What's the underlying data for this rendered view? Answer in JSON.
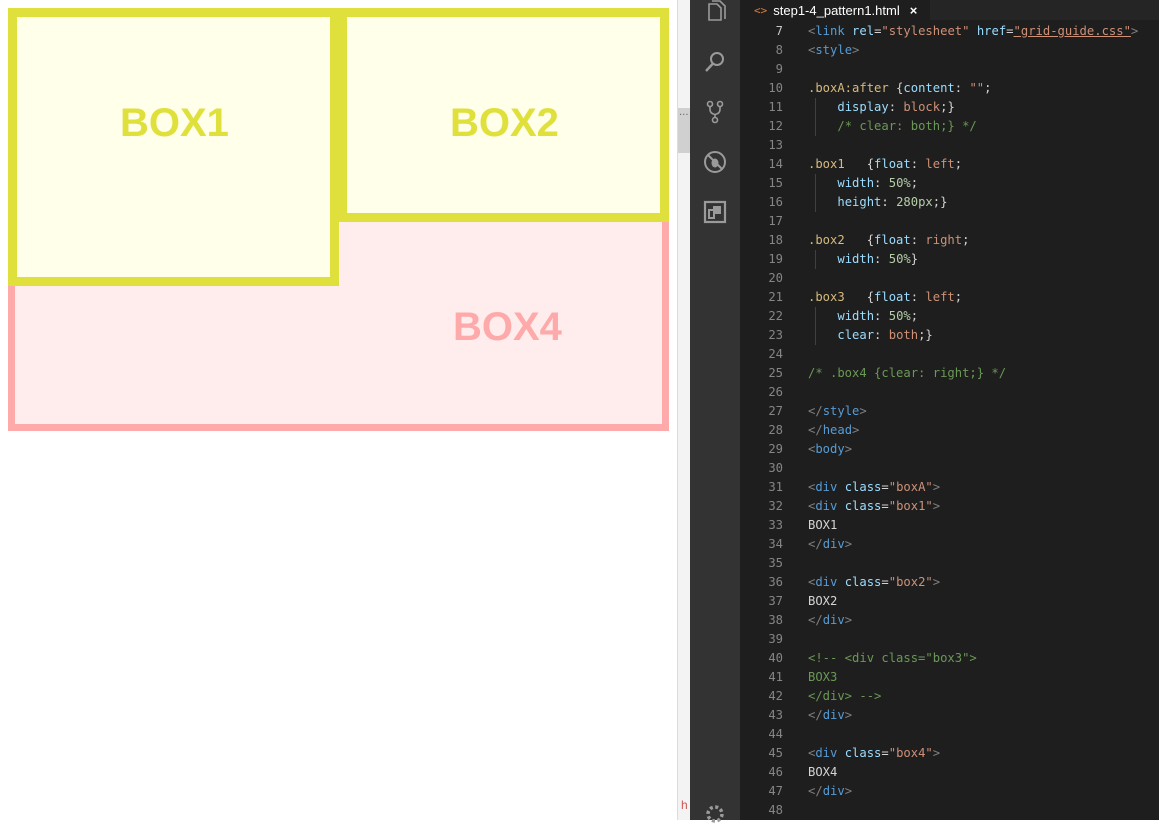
{
  "preview": {
    "box1_label": "BOX1",
    "box2_label": "BOX2",
    "box4_label": "BOX4",
    "colors": {
      "yellow": "#e0e03c",
      "pink": "#ffaaaa"
    }
  },
  "divider": {
    "grip": "···",
    "letter": "h"
  },
  "tab": {
    "icon": "<>",
    "filename": "step1-4_pattern1.html",
    "close": "×"
  },
  "activity_icons": [
    "explorer-icon",
    "search-icon",
    "source-control-icon",
    "debug-icon",
    "extensions-icon",
    "settings-gear-icon"
  ],
  "code_lines": [
    {
      "n": "7",
      "tokens": [
        [
          "t-tag",
          "<"
        ],
        [
          "t-name",
          "link"
        ],
        [
          "t-plain",
          " "
        ],
        [
          "t-attr",
          "rel"
        ],
        [
          "t-plain",
          "="
        ],
        [
          "t-str",
          "\"stylesheet\""
        ],
        [
          "t-plain",
          " "
        ],
        [
          "t-attr",
          "href"
        ],
        [
          "t-plain",
          "="
        ],
        [
          "t-link",
          "\"grid-guide.css\""
        ],
        [
          "t-tag",
          ">"
        ]
      ]
    },
    {
      "n": "8",
      "tokens": [
        [
          "t-tag",
          "<"
        ],
        [
          "t-name",
          "style"
        ],
        [
          "t-tag",
          ">"
        ]
      ]
    },
    {
      "n": "9",
      "tokens": []
    },
    {
      "n": "10",
      "tokens": [
        [
          "t-sel",
          ".boxA:after"
        ],
        [
          "t-plain",
          " {"
        ],
        [
          "t-prop",
          "content"
        ],
        [
          "t-plain",
          ": "
        ],
        [
          "t-val",
          "\"\""
        ],
        [
          "t-plain",
          ";"
        ]
      ]
    },
    {
      "n": "11",
      "tokens": [
        [
          "t-plain",
          "    "
        ],
        [
          "t-prop",
          "display"
        ],
        [
          "t-plain",
          ": "
        ],
        [
          "t-val",
          "block"
        ],
        [
          "t-plain",
          ";}"
        ]
      ]
    },
    {
      "n": "12",
      "tokens": [
        [
          "t-plain",
          "    "
        ],
        [
          "t-cmt",
          "/* clear: both;} */"
        ]
      ]
    },
    {
      "n": "13",
      "tokens": []
    },
    {
      "n": "14",
      "tokens": [
        [
          "t-sel",
          ".box1"
        ],
        [
          "t-plain",
          "   {"
        ],
        [
          "t-prop",
          "float"
        ],
        [
          "t-plain",
          ": "
        ],
        [
          "t-val",
          "left"
        ],
        [
          "t-plain",
          ";"
        ]
      ]
    },
    {
      "n": "15",
      "tokens": [
        [
          "t-plain",
          "    "
        ],
        [
          "t-prop",
          "width"
        ],
        [
          "t-plain",
          ": "
        ],
        [
          "t-num",
          "50%"
        ],
        [
          "t-plain",
          ";"
        ]
      ]
    },
    {
      "n": "16",
      "tokens": [
        [
          "t-plain",
          "    "
        ],
        [
          "t-prop",
          "height"
        ],
        [
          "t-plain",
          ": "
        ],
        [
          "t-num",
          "280px"
        ],
        [
          "t-plain",
          ";}"
        ]
      ]
    },
    {
      "n": "17",
      "tokens": []
    },
    {
      "n": "18",
      "tokens": [
        [
          "t-sel",
          ".box2"
        ],
        [
          "t-plain",
          "   {"
        ],
        [
          "t-prop",
          "float"
        ],
        [
          "t-plain",
          ": "
        ],
        [
          "t-val",
          "right"
        ],
        [
          "t-plain",
          ";"
        ]
      ]
    },
    {
      "n": "19",
      "tokens": [
        [
          "t-plain",
          "    "
        ],
        [
          "t-prop",
          "width"
        ],
        [
          "t-plain",
          ": "
        ],
        [
          "t-num",
          "50%"
        ],
        [
          "t-plain",
          "}"
        ]
      ]
    },
    {
      "n": "20",
      "tokens": []
    },
    {
      "n": "21",
      "tokens": [
        [
          "t-sel",
          ".box3"
        ],
        [
          "t-plain",
          "   {"
        ],
        [
          "t-prop",
          "float"
        ],
        [
          "t-plain",
          ": "
        ],
        [
          "t-val",
          "left"
        ],
        [
          "t-plain",
          ";"
        ]
      ]
    },
    {
      "n": "22",
      "tokens": [
        [
          "t-plain",
          "    "
        ],
        [
          "t-prop",
          "width"
        ],
        [
          "t-plain",
          ": "
        ],
        [
          "t-num",
          "50%"
        ],
        [
          "t-plain",
          ";"
        ]
      ]
    },
    {
      "n": "23",
      "tokens": [
        [
          "t-plain",
          "    "
        ],
        [
          "t-prop",
          "clear"
        ],
        [
          "t-plain",
          ": "
        ],
        [
          "t-val",
          "both"
        ],
        [
          "t-plain",
          ";}"
        ]
      ]
    },
    {
      "n": "24",
      "tokens": []
    },
    {
      "n": "25",
      "tokens": [
        [
          "t-cmt",
          "/* .box4 {clear: right;} */"
        ]
      ]
    },
    {
      "n": "26",
      "tokens": []
    },
    {
      "n": "27",
      "tokens": [
        [
          "t-tag",
          "</"
        ],
        [
          "t-name",
          "style"
        ],
        [
          "t-tag",
          ">"
        ]
      ]
    },
    {
      "n": "28",
      "tokens": [
        [
          "t-tag",
          "</"
        ],
        [
          "t-name",
          "head"
        ],
        [
          "t-tag",
          ">"
        ]
      ]
    },
    {
      "n": "29",
      "tokens": [
        [
          "t-tag",
          "<"
        ],
        [
          "t-name",
          "body"
        ],
        [
          "t-tag",
          ">"
        ]
      ]
    },
    {
      "n": "30",
      "tokens": []
    },
    {
      "n": "31",
      "tokens": [
        [
          "t-tag",
          "<"
        ],
        [
          "t-name",
          "div"
        ],
        [
          "t-plain",
          " "
        ],
        [
          "t-attr",
          "class"
        ],
        [
          "t-plain",
          "="
        ],
        [
          "t-str",
          "\"boxA\""
        ],
        [
          "t-tag",
          ">"
        ]
      ]
    },
    {
      "n": "32",
      "tokens": [
        [
          "t-tag",
          "<"
        ],
        [
          "t-name",
          "div"
        ],
        [
          "t-plain",
          " "
        ],
        [
          "t-attr",
          "class"
        ],
        [
          "t-plain",
          "="
        ],
        [
          "t-str",
          "\"box1\""
        ],
        [
          "t-tag",
          ">"
        ]
      ]
    },
    {
      "n": "33",
      "tokens": [
        [
          "t-plain",
          "BOX1"
        ]
      ]
    },
    {
      "n": "34",
      "tokens": [
        [
          "t-tag",
          "</"
        ],
        [
          "t-name",
          "div"
        ],
        [
          "t-tag",
          ">"
        ]
      ]
    },
    {
      "n": "35",
      "tokens": []
    },
    {
      "n": "36",
      "tokens": [
        [
          "t-tag",
          "<"
        ],
        [
          "t-name",
          "div"
        ],
        [
          "t-plain",
          " "
        ],
        [
          "t-attr",
          "class"
        ],
        [
          "t-plain",
          "="
        ],
        [
          "t-str",
          "\"box2\""
        ],
        [
          "t-tag",
          ">"
        ]
      ]
    },
    {
      "n": "37",
      "tokens": [
        [
          "t-plain",
          "BOX2"
        ]
      ]
    },
    {
      "n": "38",
      "tokens": [
        [
          "t-tag",
          "</"
        ],
        [
          "t-name",
          "div"
        ],
        [
          "t-tag",
          ">"
        ]
      ]
    },
    {
      "n": "39",
      "tokens": []
    },
    {
      "n": "40",
      "tokens": [
        [
          "t-cmt",
          "<!-- <div class=\"box3\">"
        ]
      ]
    },
    {
      "n": "41",
      "tokens": [
        [
          "t-cmt",
          "BOX3"
        ]
      ]
    },
    {
      "n": "42",
      "tokens": [
        [
          "t-cmt",
          "</div> -->"
        ]
      ]
    },
    {
      "n": "43",
      "tokens": [
        [
          "t-tag",
          "</"
        ],
        [
          "t-name",
          "div"
        ],
        [
          "t-tag",
          ">"
        ]
      ]
    },
    {
      "n": "44",
      "tokens": []
    },
    {
      "n": "45",
      "tokens": [
        [
          "t-tag",
          "<"
        ],
        [
          "t-name",
          "div"
        ],
        [
          "t-plain",
          " "
        ],
        [
          "t-attr",
          "class"
        ],
        [
          "t-plain",
          "="
        ],
        [
          "t-str",
          "\"box4\""
        ],
        [
          "t-tag",
          ">"
        ]
      ]
    },
    {
      "n": "46",
      "tokens": [
        [
          "t-plain",
          "BOX4"
        ]
      ]
    },
    {
      "n": "47",
      "tokens": [
        [
          "t-tag",
          "</"
        ],
        [
          "t-name",
          "div"
        ],
        [
          "t-tag",
          ">"
        ]
      ]
    },
    {
      "n": "48",
      "tokens": []
    }
  ],
  "active_line": "7"
}
